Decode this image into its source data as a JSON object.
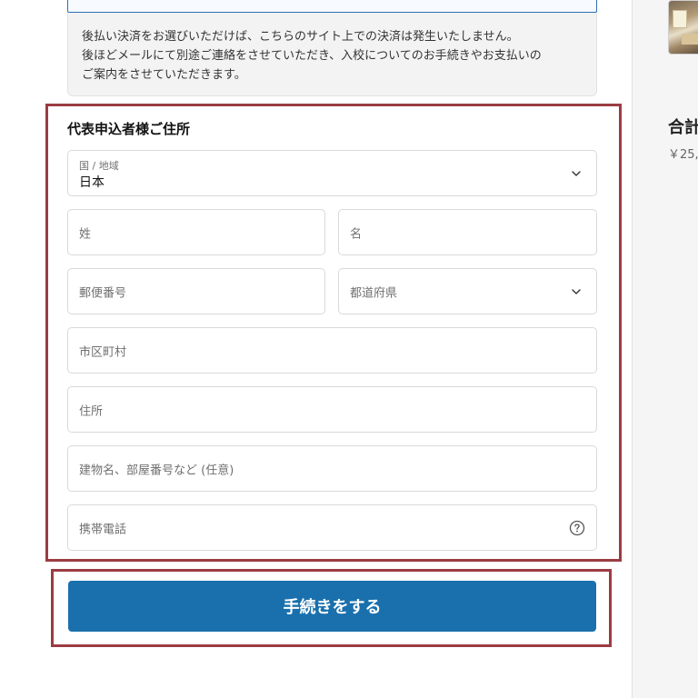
{
  "notice": {
    "line1": "後払い決済をお選びいただけば、こちらのサイト上での決済は発生いたしません。",
    "line2": "後ほどメールにて別途ご連絡をさせていただき、入校についてのお手続きやお支払いの",
    "line3": "ご案内をさせていただきます。"
  },
  "address": {
    "title": "代表申込者様ご住所",
    "country": {
      "label": "国 / 地域",
      "value": "日本"
    },
    "last_name": {
      "placeholder": "姓"
    },
    "first_name": {
      "placeholder": "名"
    },
    "postal_code": {
      "placeholder": "郵便番号"
    },
    "prefecture": {
      "placeholder": "都道府県"
    },
    "city": {
      "placeholder": "市区町村"
    },
    "street": {
      "placeholder": "住所"
    },
    "building": {
      "placeholder": "建物名、部屋番号など (任意)"
    },
    "phone": {
      "placeholder": "携帯電話"
    }
  },
  "submit": {
    "label": "手続きをする"
  },
  "summary": {
    "total_label": "合計",
    "total_price": "￥25,"
  },
  "colors": {
    "accent": "#1a70ad",
    "highlight": "#9b3c42"
  },
  "icons": {
    "chevron": "chevron-down-icon",
    "help": "question-circle-icon"
  }
}
